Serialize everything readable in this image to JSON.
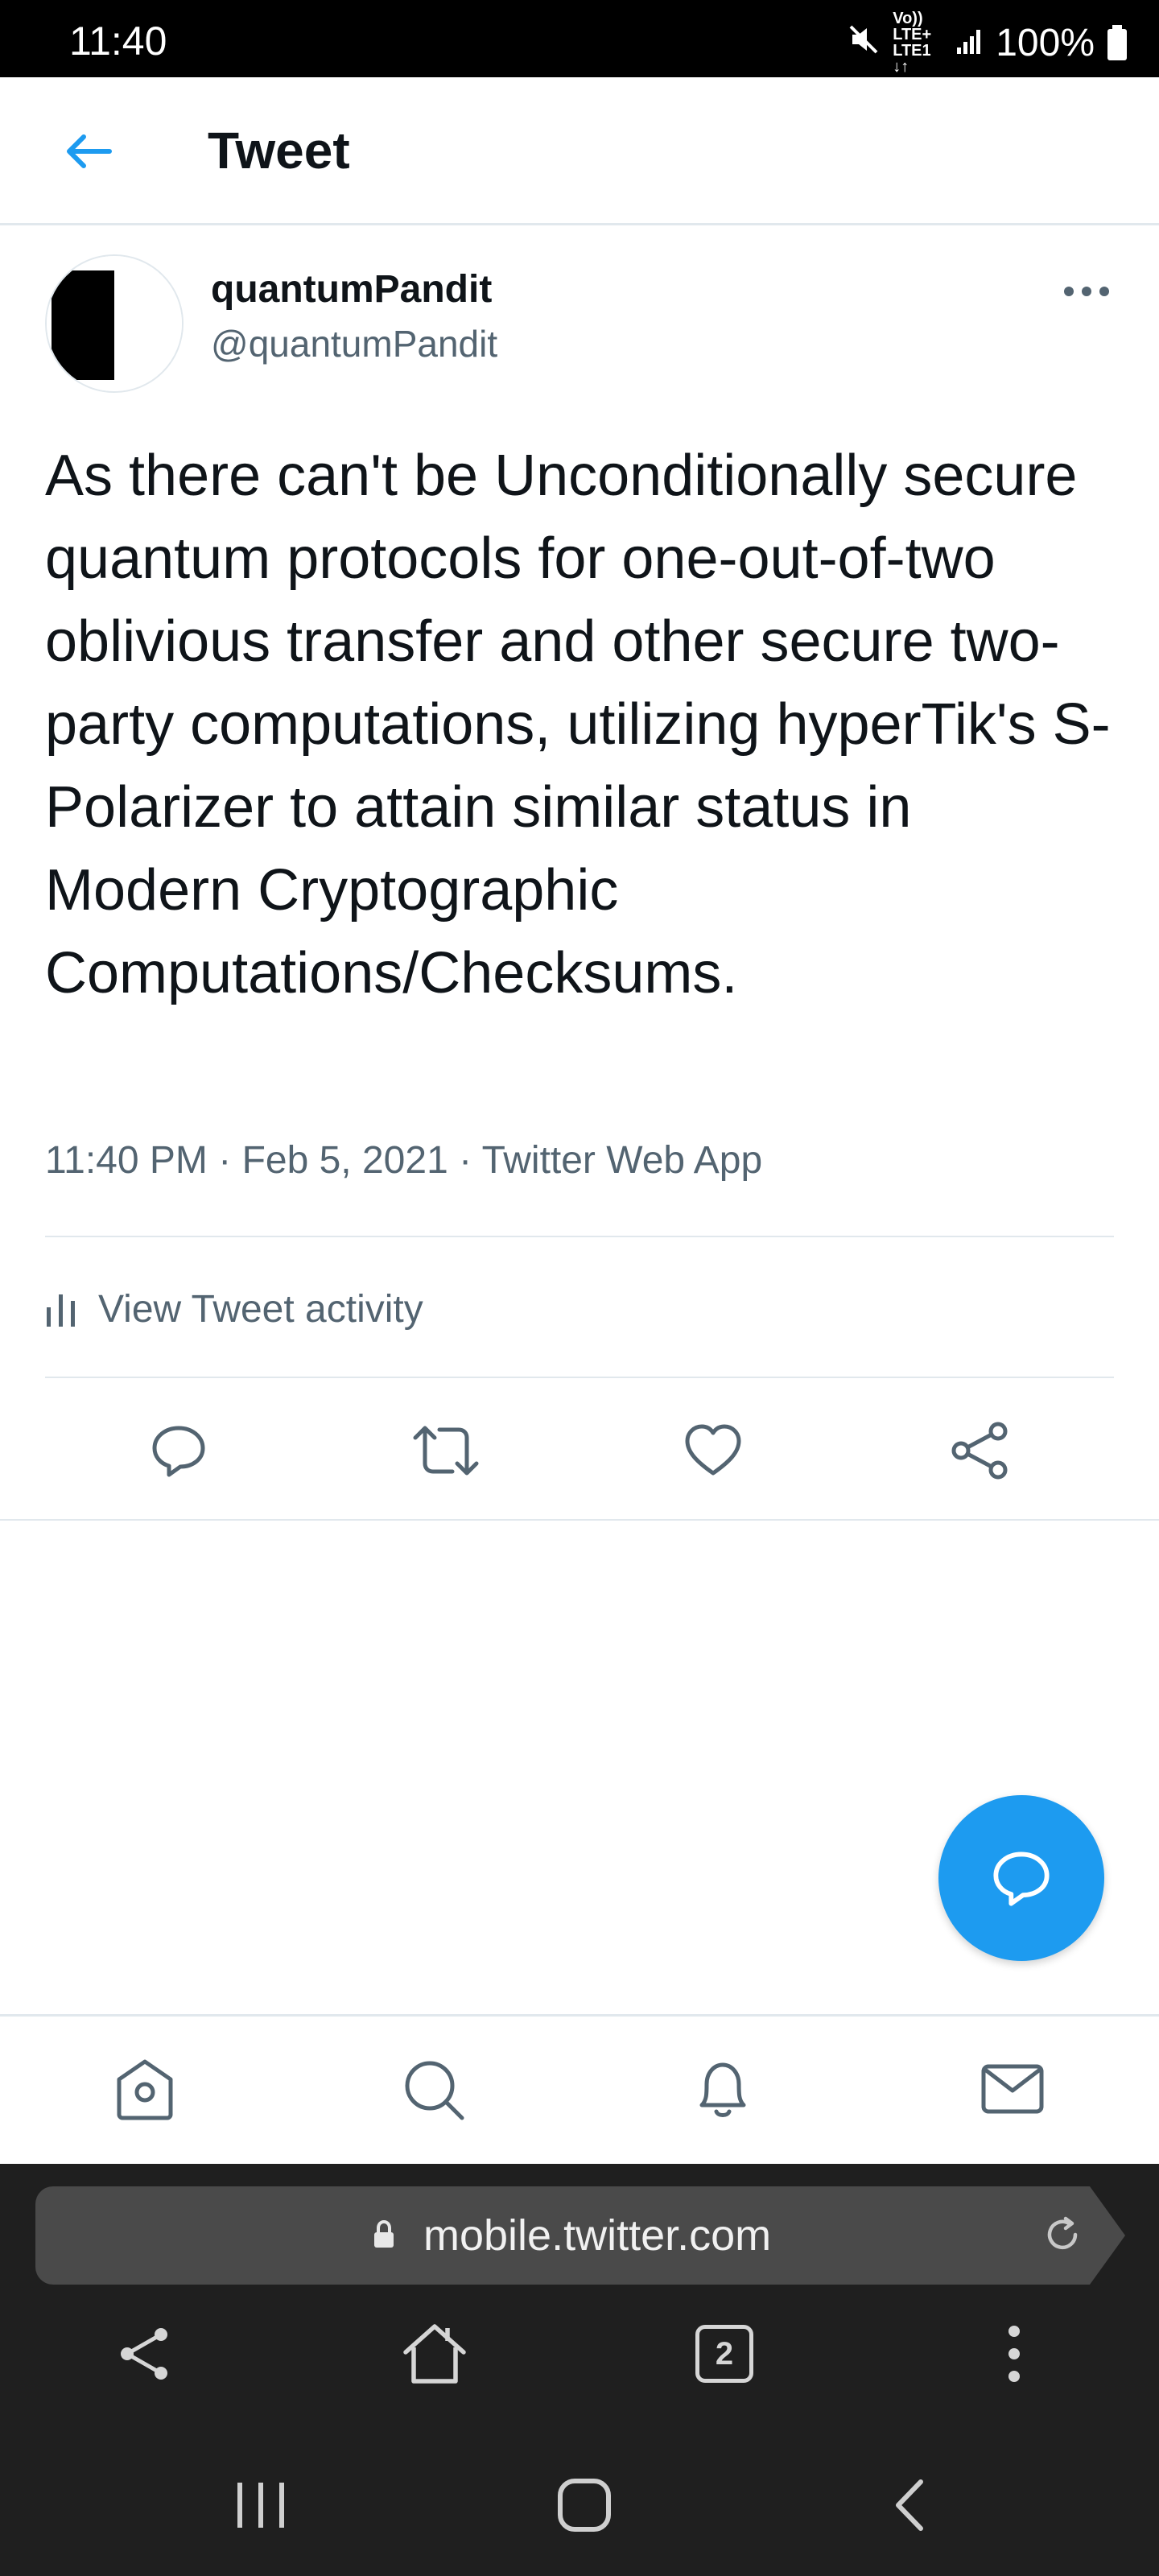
{
  "status_bar": {
    "time": "11:40",
    "network_top": "Vo)) LTE+",
    "network_bottom": "LTE1 ↓↑",
    "battery": "100%"
  },
  "header": {
    "title": "Tweet",
    "back_icon": "arrow-left-icon"
  },
  "tweet": {
    "author_name": "quantumPandit",
    "author_handle": "@quantumPandit",
    "text": "As there can't be Unconditionally secure quantum protocols for one-out-of-two oblivious transfer and other secure two-party computations, utilizing hyperTik's S-Polarizer to attain similar status in Modern Cryptographic Computations/Checksums.",
    "time": "11:40 PM",
    "date": "Feb 5, 2021",
    "source": "Twitter Web App",
    "separator": "·"
  },
  "activity": {
    "label": "View Tweet activity"
  },
  "actions": [
    "reply-icon",
    "retweet-icon",
    "like-icon",
    "share-icon"
  ],
  "tab_bar": [
    "home-icon",
    "search-icon",
    "notifications-icon",
    "messages-icon"
  ],
  "browser": {
    "url": "mobile.twitter.com",
    "tab_count": "2"
  },
  "colors": {
    "accent": "#1d9bf0",
    "text": "#0f1419",
    "secondary_text": "#536471",
    "divider": "#e1e8ed",
    "browser_bg": "#1f1f1f"
  }
}
